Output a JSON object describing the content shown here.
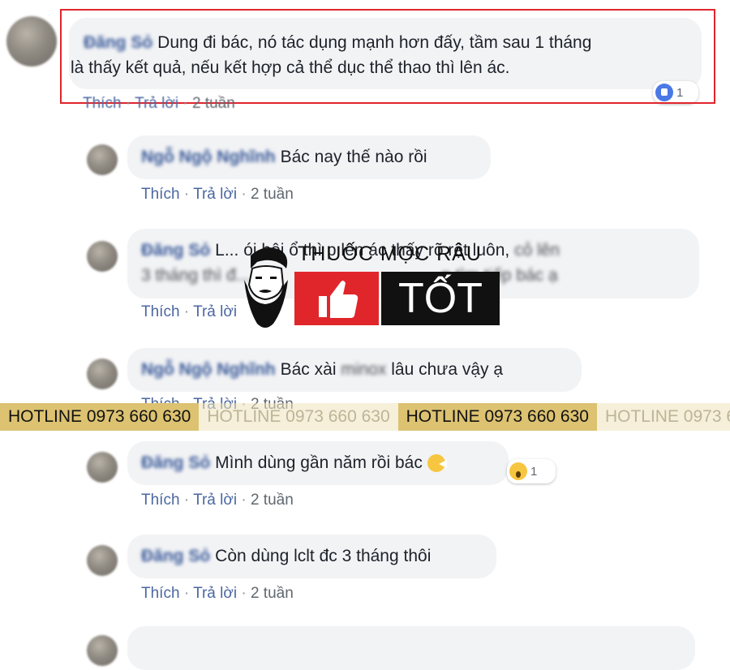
{
  "comments": [
    {
      "name": "Đăng Sỏ",
      "text": "Dung đi bác, nó tác dụng mạnh hơn đấy, tầm sau 1 tháng",
      "text2": "là thấy kết quả, nếu kết hợp cả thể dục thể thao thì lên ác."
    },
    {
      "name": "Ngỗ Ngộ Nghĩnh",
      "text": "Bác nay thế nào rồi"
    },
    {
      "name": "Đăng Sỏ",
      "text": "L... ói hôi ổ thì p lên ác thấy rõ rệt luôn,",
      "blur_tail": "cỏ lên",
      "text2": "3 tháng thì đ...",
      "blur_tail2": "n tìm tiếp bác ạ"
    },
    {
      "name": "Ngỗ Ngộ Nghĩnh",
      "text_before": "Bác xài",
      "blur_mid": "minox",
      "text_after": "lâu chưa vậy ạ"
    },
    {
      "name": "Đăng Sỏ",
      "text": "Mình dùng gần năm rồi bác"
    },
    {
      "name": "Đăng Sỏ",
      "text": "Còn dùng lclt đc 3 tháng thôi"
    }
  ],
  "actions": {
    "like": "Thích",
    "reply": "Trả lời",
    "time": "2 tuần",
    "sep": "·"
  },
  "reactions": {
    "like_count": "1",
    "wow_count": "1"
  },
  "logo": {
    "title": "THUỐC MỌC RÂU",
    "word": "TỐT"
  },
  "hotline": {
    "text": "HOTLINE 0973 660 630"
  },
  "colors": {
    "highlight": "#e0252c",
    "link": "#385898",
    "bubble": "#f2f3f5",
    "logo_red": "#e0262a",
    "hotline_bg": "#dcc271"
  }
}
